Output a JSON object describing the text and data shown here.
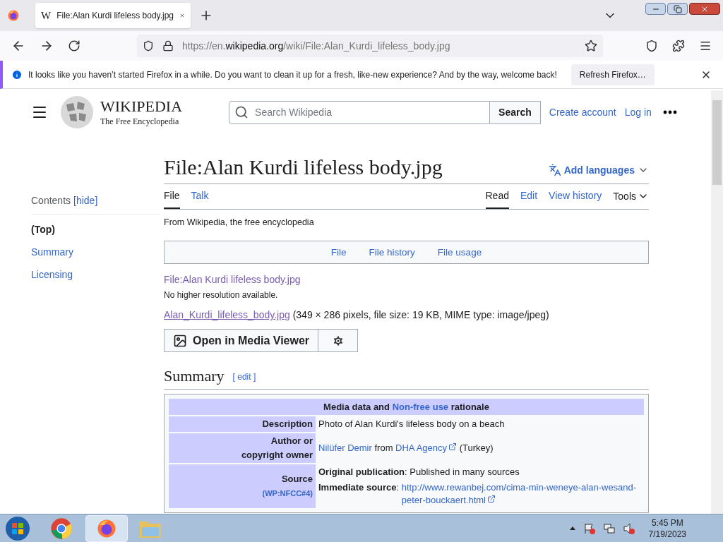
{
  "browser": {
    "tab_title": "File:Alan Kurdi lifeless body.jpg",
    "tab_favicon": "W",
    "url_prefix": "https://en.",
    "url_domain": "wikipedia.org",
    "url_path": "/wiki/File:Alan_Kurdi_lifeless_body.jpg"
  },
  "notification": {
    "message": "It looks like you haven’t started Firefox in a while. Do you want to clean it up for a fresh, like-new experience? And by the way, welcome back!",
    "button": "Refresh Firefox…"
  },
  "header": {
    "logo_title": "WIKIPEDIA",
    "logo_tagline": "The Free Encyclopedia",
    "search_placeholder": "Search Wikipedia",
    "search_button": "Search",
    "links": [
      "Create account",
      "Log in"
    ]
  },
  "title": "File:Alan Kurdi lifeless body.jpg",
  "add_languages": "Add languages",
  "page_tabs": [
    {
      "label": "File",
      "selected": true
    },
    {
      "label": "Talk",
      "selected": false
    }
  ],
  "view_tabs": [
    {
      "label": "Read",
      "selected": true
    },
    {
      "label": "Edit",
      "selected": false
    },
    {
      "label": "View history",
      "selected": false
    }
  ],
  "tools": "Tools",
  "toc": {
    "heading": "Contents",
    "toggle": "[hide]",
    "items": [
      {
        "label": "(Top)",
        "selected": true
      },
      {
        "label": "Summary",
        "selected": false
      },
      {
        "label": "Licensing",
        "selected": false
      }
    ]
  },
  "tagline": "From Wikipedia, the free encyclopedia",
  "file_nav": [
    "File",
    "File history",
    "File usage"
  ],
  "file_link": "File:Alan Kurdi lifeless body.jpg",
  "no_higher": "No higher resolution available.",
  "file_name": "Alan_Kurdi_lifeless_body.jpg",
  "file_info": "(349 × 286 pixels, file size: 19 KB, MIME type: image/jpeg)",
  "media_viewer_button": "Open in Media Viewer",
  "summary": {
    "heading": "Summary",
    "edit": "[ edit ]"
  },
  "table": {
    "header": [
      {
        "kind": "bold",
        "text": "Media data and "
      },
      {
        "kind": "link",
        "text": "Non-free use"
      },
      {
        "kind": "bold",
        "text": " rationale"
      }
    ],
    "rows": [
      {
        "label": "Description",
        "values": [
          [
            {
              "kind": "text",
              "text": "Photo of Alan Kurdi's lifeless body on a beach"
            }
          ]
        ]
      },
      {
        "label": "Author or copyright owner",
        "values": [
          [
            {
              "kind": "link",
              "text": "Nilüfer Demir"
            },
            {
              "kind": "text",
              "text": " from "
            },
            {
              "kind": "external",
              "text": "DHA Agency"
            },
            {
              "kind": "text",
              "text": " (Turkey)"
            }
          ]
        ]
      },
      {
        "label": "Source",
        "label_link": "(WP:NFCC#4)",
        "values": [
          [
            {
              "kind": "bold",
              "text": "Original publication"
            },
            {
              "kind": "text",
              "text": ": Published in many sources"
            }
          ],
          [
            {
              "kind": "bold",
              "text": "Immediate source"
            },
            {
              "kind": "text",
              "text": ": "
            },
            {
              "kind": "external",
              "text": "http://www.rewanbej.com/cima-min-weneye-alan-wesand-peter-bouckaert.html"
            }
          ]
        ]
      }
    ]
  },
  "taskbar": {
    "time": "5:45 PM",
    "date": "7/19/2023"
  }
}
